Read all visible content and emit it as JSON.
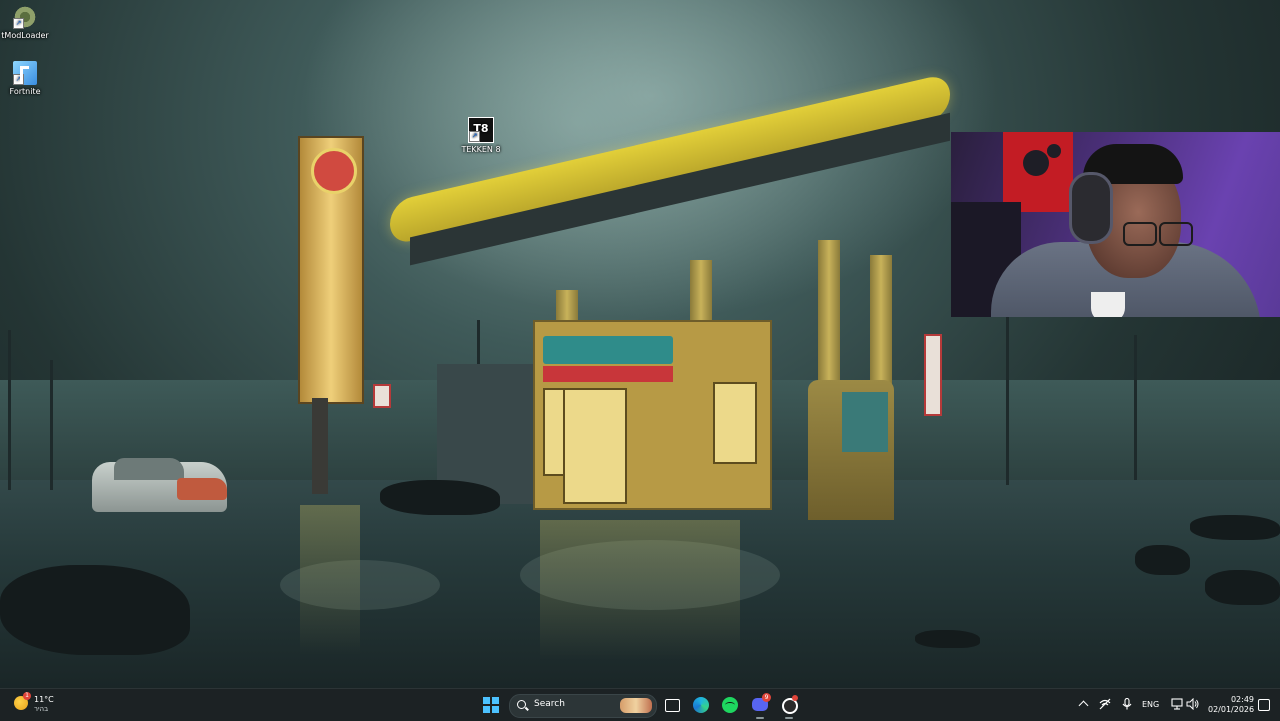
{
  "desktop": {
    "icons": [
      {
        "label": "tModLoader",
        "icon": "gear-icon"
      },
      {
        "label": "Fortnite",
        "icon": "fortnite-icon"
      },
      {
        "label": "TEKKEN 8",
        "icon": "tekken-icon"
      }
    ]
  },
  "taskbar": {
    "weather": {
      "temp": "11°C",
      "condition": "בהיר",
      "icon": "sun-icon",
      "badge": "1"
    },
    "search": {
      "label": "Search"
    },
    "apps": [
      {
        "name": "Task View",
        "icon": "task-view-icon"
      },
      {
        "name": "Microsoft Edge",
        "icon": "edge-icon"
      },
      {
        "name": "Spotify",
        "icon": "spotify-icon"
      },
      {
        "name": "Discord",
        "icon": "discord-icon",
        "badge": "9"
      },
      {
        "name": "OBS Studio",
        "icon": "obs-icon"
      }
    ],
    "tray": {
      "language": "ENG",
      "time": "02:49",
      "date": "02/01/2026"
    }
  },
  "colors": {
    "taskbar_bg": "#1c2224",
    "accent": "#4cc2ff",
    "canopy_yellow": "#e2cf39",
    "webcam_purple": "#6a42b0"
  }
}
